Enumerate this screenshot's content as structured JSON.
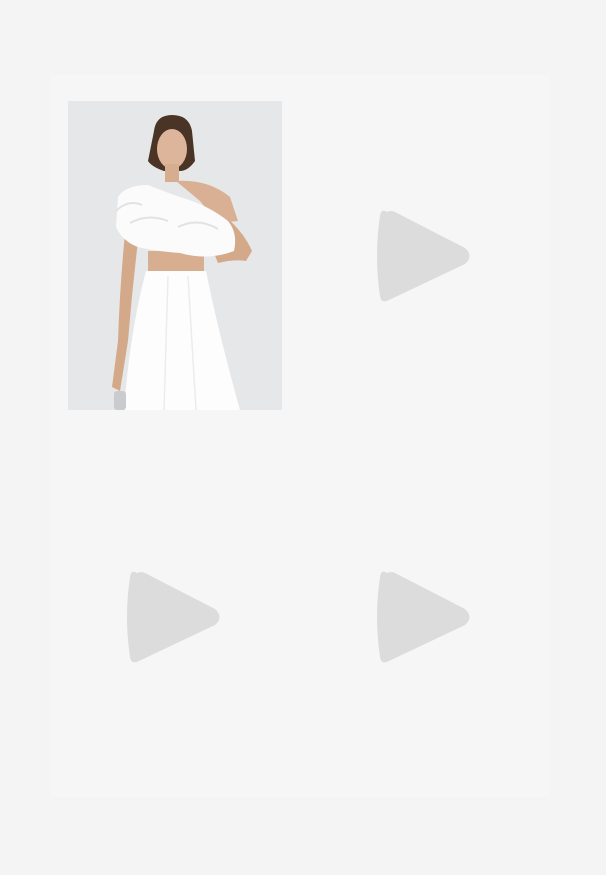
{
  "gallery": {
    "items": [
      {
        "type": "image",
        "alt": ""
      },
      {
        "type": "video",
        "icon": "play-icon"
      },
      {
        "type": "video",
        "icon": "play-icon"
      },
      {
        "type": "video",
        "icon": "play-icon"
      }
    ]
  },
  "colors": {
    "page_background": "#f4f4f4",
    "tile_background": "#f6f6f6",
    "placeholder_icon": "#dcdcdc",
    "photo_background": "#e6e7e9"
  }
}
